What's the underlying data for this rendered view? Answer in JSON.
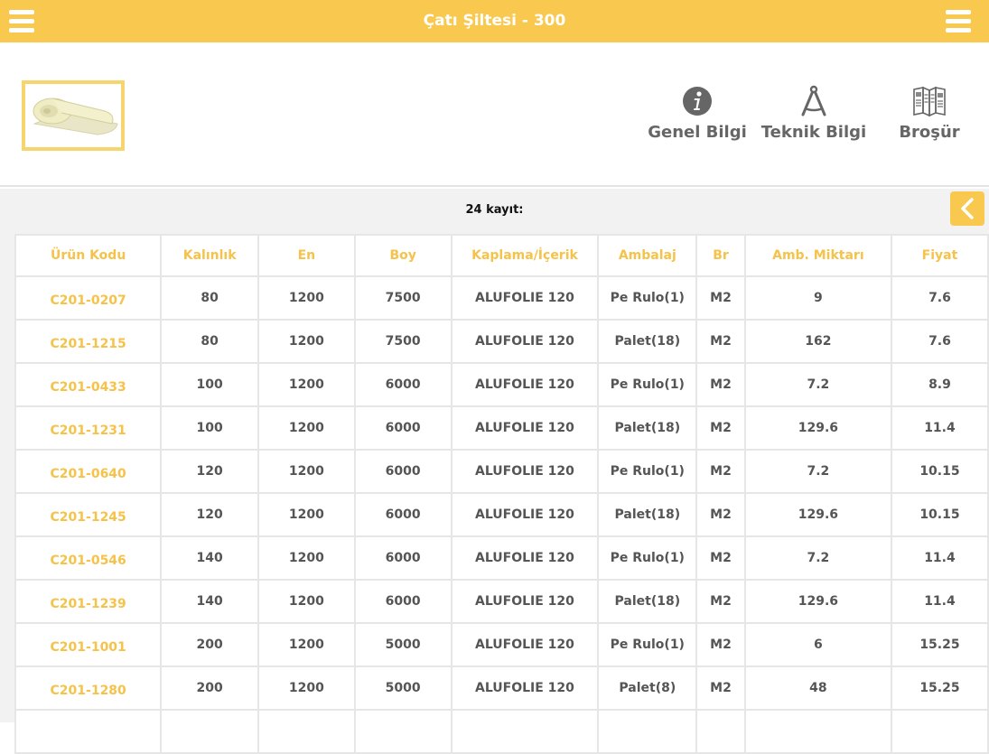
{
  "app": {
    "title": "Çatı Şiltesi - 300"
  },
  "colors": {
    "accent": "#F8C94E",
    "link": "#F5C24A",
    "text": "#555555",
    "icon": "#666666"
  },
  "header": {
    "actions": [
      {
        "label": "Genel Bilgi",
        "icon": "info-icon"
      },
      {
        "label": "Teknik Bilgi",
        "icon": "compass-icon"
      },
      {
        "label": "Broşür",
        "icon": "brochure-icon"
      }
    ]
  },
  "list": {
    "record_count": "24 kayıt:",
    "columns": [
      "Ürün Kodu",
      "Kalınlık",
      "En",
      "Boy",
      "Kaplama/İçerik",
      "Ambalaj",
      "Br",
      "Amb. Miktarı",
      "Fiyat"
    ],
    "rows": [
      [
        "C201-0207",
        "80",
        "1200",
        "7500",
        "ALUFOLIE 120",
        "Pe Rulo(1)",
        "M2",
        "9",
        "7.6"
      ],
      [
        "C201-1215",
        "80",
        "1200",
        "7500",
        "ALUFOLIE 120",
        "Palet(18)",
        "M2",
        "162",
        "7.6"
      ],
      [
        "C201-0433",
        "100",
        "1200",
        "6000",
        "ALUFOLIE 120",
        "Pe Rulo(1)",
        "M2",
        "7.2",
        "8.9"
      ],
      [
        "C201-1231",
        "100",
        "1200",
        "6000",
        "ALUFOLIE 120",
        "Palet(18)",
        "M2",
        "129.6",
        "11.4"
      ],
      [
        "C201-0640",
        "120",
        "1200",
        "6000",
        "ALUFOLIE 120",
        "Pe Rulo(1)",
        "M2",
        "7.2",
        "10.15"
      ],
      [
        "C201-1245",
        "120",
        "1200",
        "6000",
        "ALUFOLIE 120",
        "Palet(18)",
        "M2",
        "129.6",
        "10.15"
      ],
      [
        "C201-0546",
        "140",
        "1200",
        "6000",
        "ALUFOLIE 120",
        "Pe Rulo(1)",
        "M2",
        "7.2",
        "11.4"
      ],
      [
        "C201-1239",
        "140",
        "1200",
        "6000",
        "ALUFOLIE 120",
        "Palet(18)",
        "M2",
        "129.6",
        "11.4"
      ],
      [
        "C201-1001",
        "200",
        "1200",
        "5000",
        "ALUFOLIE 120",
        "Pe Rulo(1)",
        "M2",
        "6",
        "15.25"
      ],
      [
        "C201-1280",
        "200",
        "1200",
        "5000",
        "ALUFOLIE 120",
        "Palet(8)",
        "M2",
        "48",
        "15.25"
      ],
      [
        "",
        "",
        "",
        "",
        "",
        "",
        "",
        "",
        ""
      ]
    ]
  }
}
